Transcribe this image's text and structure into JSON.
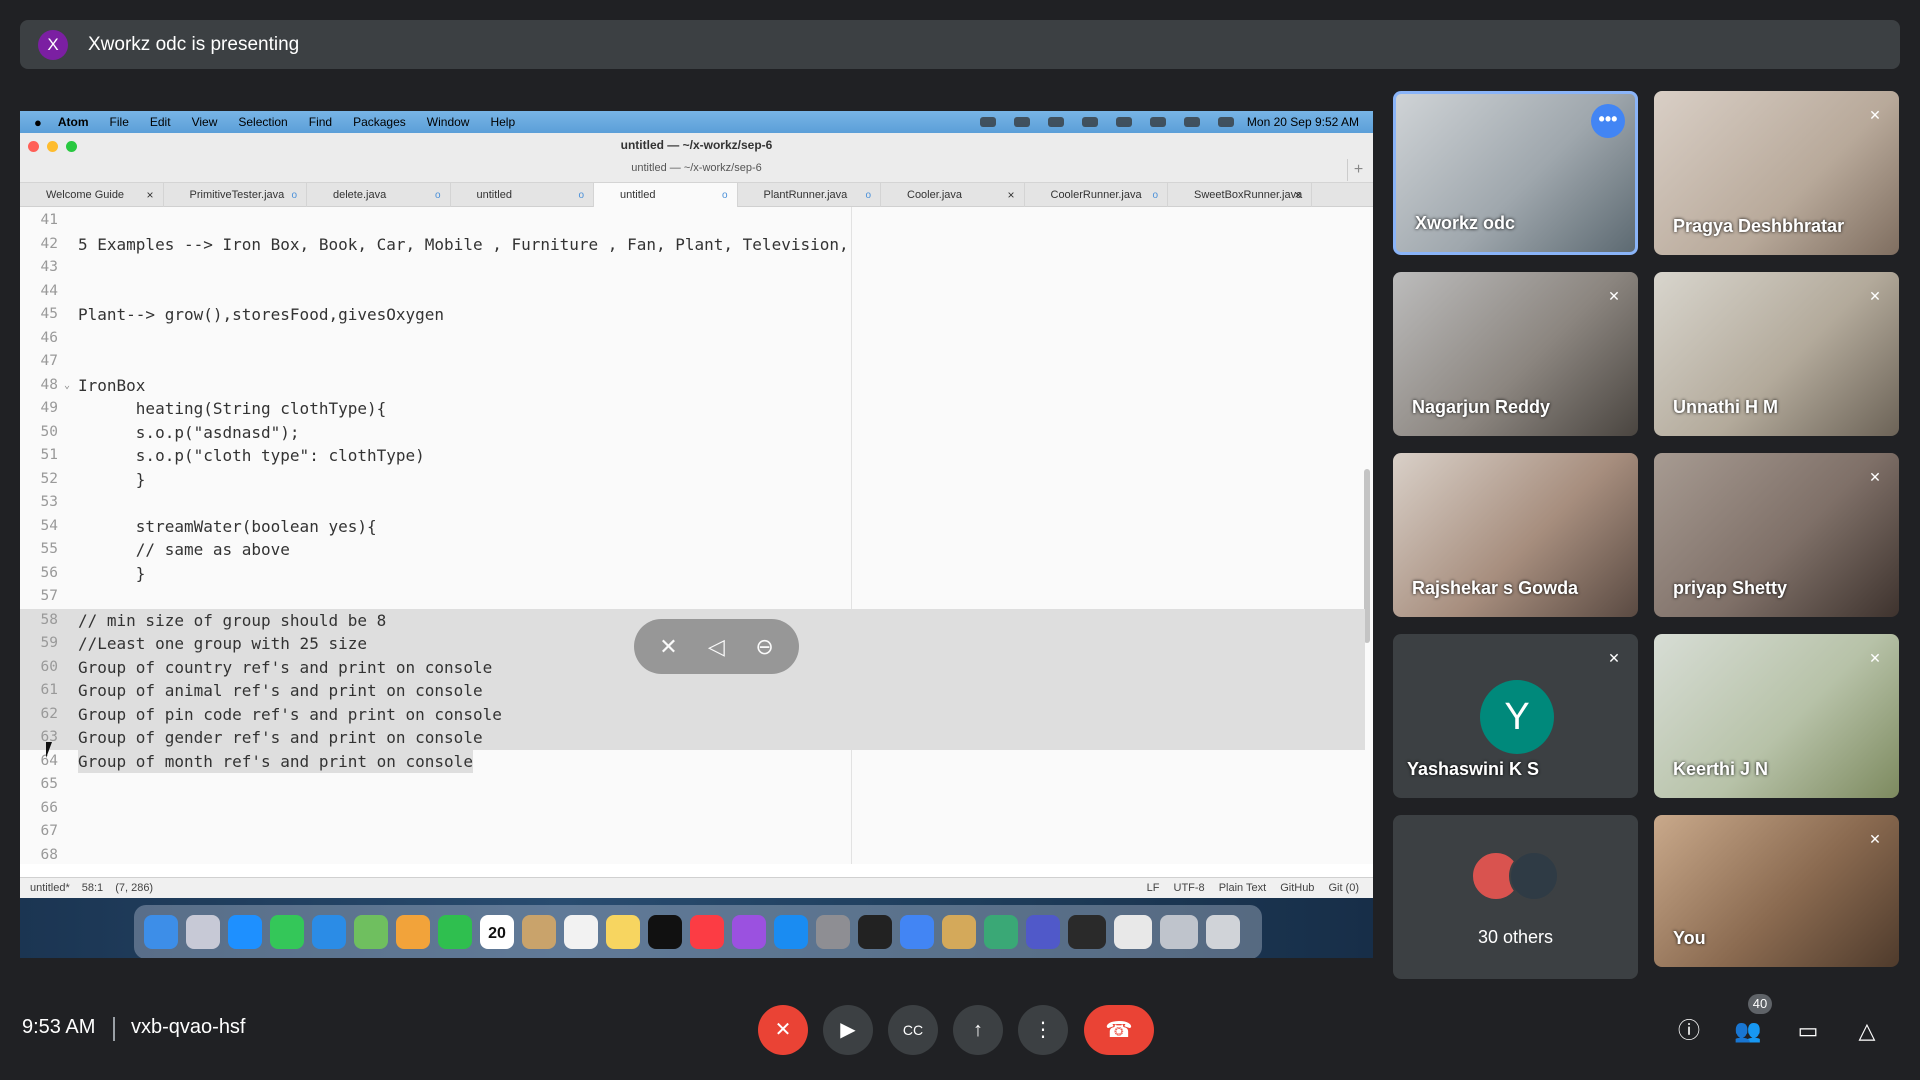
{
  "banner": {
    "avatar_letter": "X",
    "text": "Xworkz odc is presenting"
  },
  "presentation": {
    "menubar": {
      "apple": "",
      "app": "Atom",
      "items": [
        "File",
        "Edit",
        "View",
        "Selection",
        "Find",
        "Packages",
        "Window",
        "Help"
      ],
      "clock": "Mon 20 Sep  9:52 AM"
    },
    "window_title": "untitled — ~/x-workz/sep-6",
    "window_subtitle": "untitled — ~/x-workz/sep-6",
    "tabs": [
      {
        "label": "Welcome Guide",
        "mark": "×"
      },
      {
        "label": "PrimitiveTester.java",
        "mark": "o"
      },
      {
        "label": "delete.java",
        "mark": "o"
      },
      {
        "label": "untitled",
        "mark": "o"
      },
      {
        "label": "untitled",
        "mark": "o"
      },
      {
        "label": "PlantRunner.java",
        "mark": "o"
      },
      {
        "label": "Cooler.java",
        "mark": "×"
      },
      {
        "label": "CoolerRunner.java",
        "mark": "o"
      },
      {
        "label": "SweetBoxRunner.java",
        "mark": "×"
      }
    ],
    "lines": [
      {
        "n": "41",
        "t": ""
      },
      {
        "n": "42",
        "t": "5 Examples --> Iron Box, Book, Car, Mobile , Furniture , Fan, Plant, Television,"
      },
      {
        "n": "43",
        "t": ""
      },
      {
        "n": "44",
        "t": ""
      },
      {
        "n": "45",
        "t": "Plant--> grow(),storesFood,givesOxygen"
      },
      {
        "n": "46",
        "t": ""
      },
      {
        "n": "47",
        "t": ""
      },
      {
        "n": "48",
        "t": "IronBox"
      },
      {
        "n": "49",
        "t": "      heating(String clothType){"
      },
      {
        "n": "50",
        "t": "      s.o.p(\"asdnasd\");"
      },
      {
        "n": "51",
        "t": "      s.o.p(\"cloth type\": clothType)"
      },
      {
        "n": "52",
        "t": "      }"
      },
      {
        "n": "53",
        "t": ""
      },
      {
        "n": "54",
        "t": "      streamWater(boolean yes){"
      },
      {
        "n": "55",
        "t": "      // same as above"
      },
      {
        "n": "56",
        "t": "      }"
      },
      {
        "n": "57",
        "t": ""
      },
      {
        "n": "58",
        "t": "// min size of group should be 8"
      },
      {
        "n": "59",
        "t": "//Least one group with 25 size"
      },
      {
        "n": "60",
        "t": "Group of country ref's and print on console"
      },
      {
        "n": "61",
        "t": "Group of animal ref's and print on console"
      },
      {
        "n": "62",
        "t": "Group of pin code ref's and print on console"
      },
      {
        "n": "63",
        "t": "Group of gender ref's and print on console"
      },
      {
        "n": "64",
        "t": "Group of month ref's and print on console"
      },
      {
        "n": "65",
        "t": ""
      },
      {
        "n": "66",
        "t": ""
      },
      {
        "n": "67",
        "t": ""
      },
      {
        "n": "68",
        "t": ""
      }
    ],
    "status": {
      "file": "untitled*",
      "pos": "58:1",
      "sel": "(7, 286)",
      "eol": "LF",
      "encoding": "UTF-8",
      "grammar": "Plain Text",
      "github": "GitHub",
      "git": "Git (0)"
    },
    "dock_calendar": "20"
  },
  "participants": [
    {
      "name": "Xworkz odc"
    },
    {
      "name": "Pragya Deshbhratar"
    },
    {
      "name": "Nagarjun Reddy"
    },
    {
      "name": "Unnathi H M"
    },
    {
      "name": "Rajshekar s Gowda"
    },
    {
      "name": "priyap Shetty"
    },
    {
      "name": "Yashaswini K S",
      "avatar": "Y"
    },
    {
      "name": "Keerthi J N"
    },
    {
      "name": "30 others"
    },
    {
      "name": "You"
    }
  ],
  "bottom": {
    "time": "9:53 AM",
    "meeting_code": "vxb-qvao-hsf",
    "people_count": "40"
  },
  "colors": {
    "end_call": "#ea4335",
    "selected_tile": "#8ab4f8",
    "avatar_y": "#00897b"
  }
}
